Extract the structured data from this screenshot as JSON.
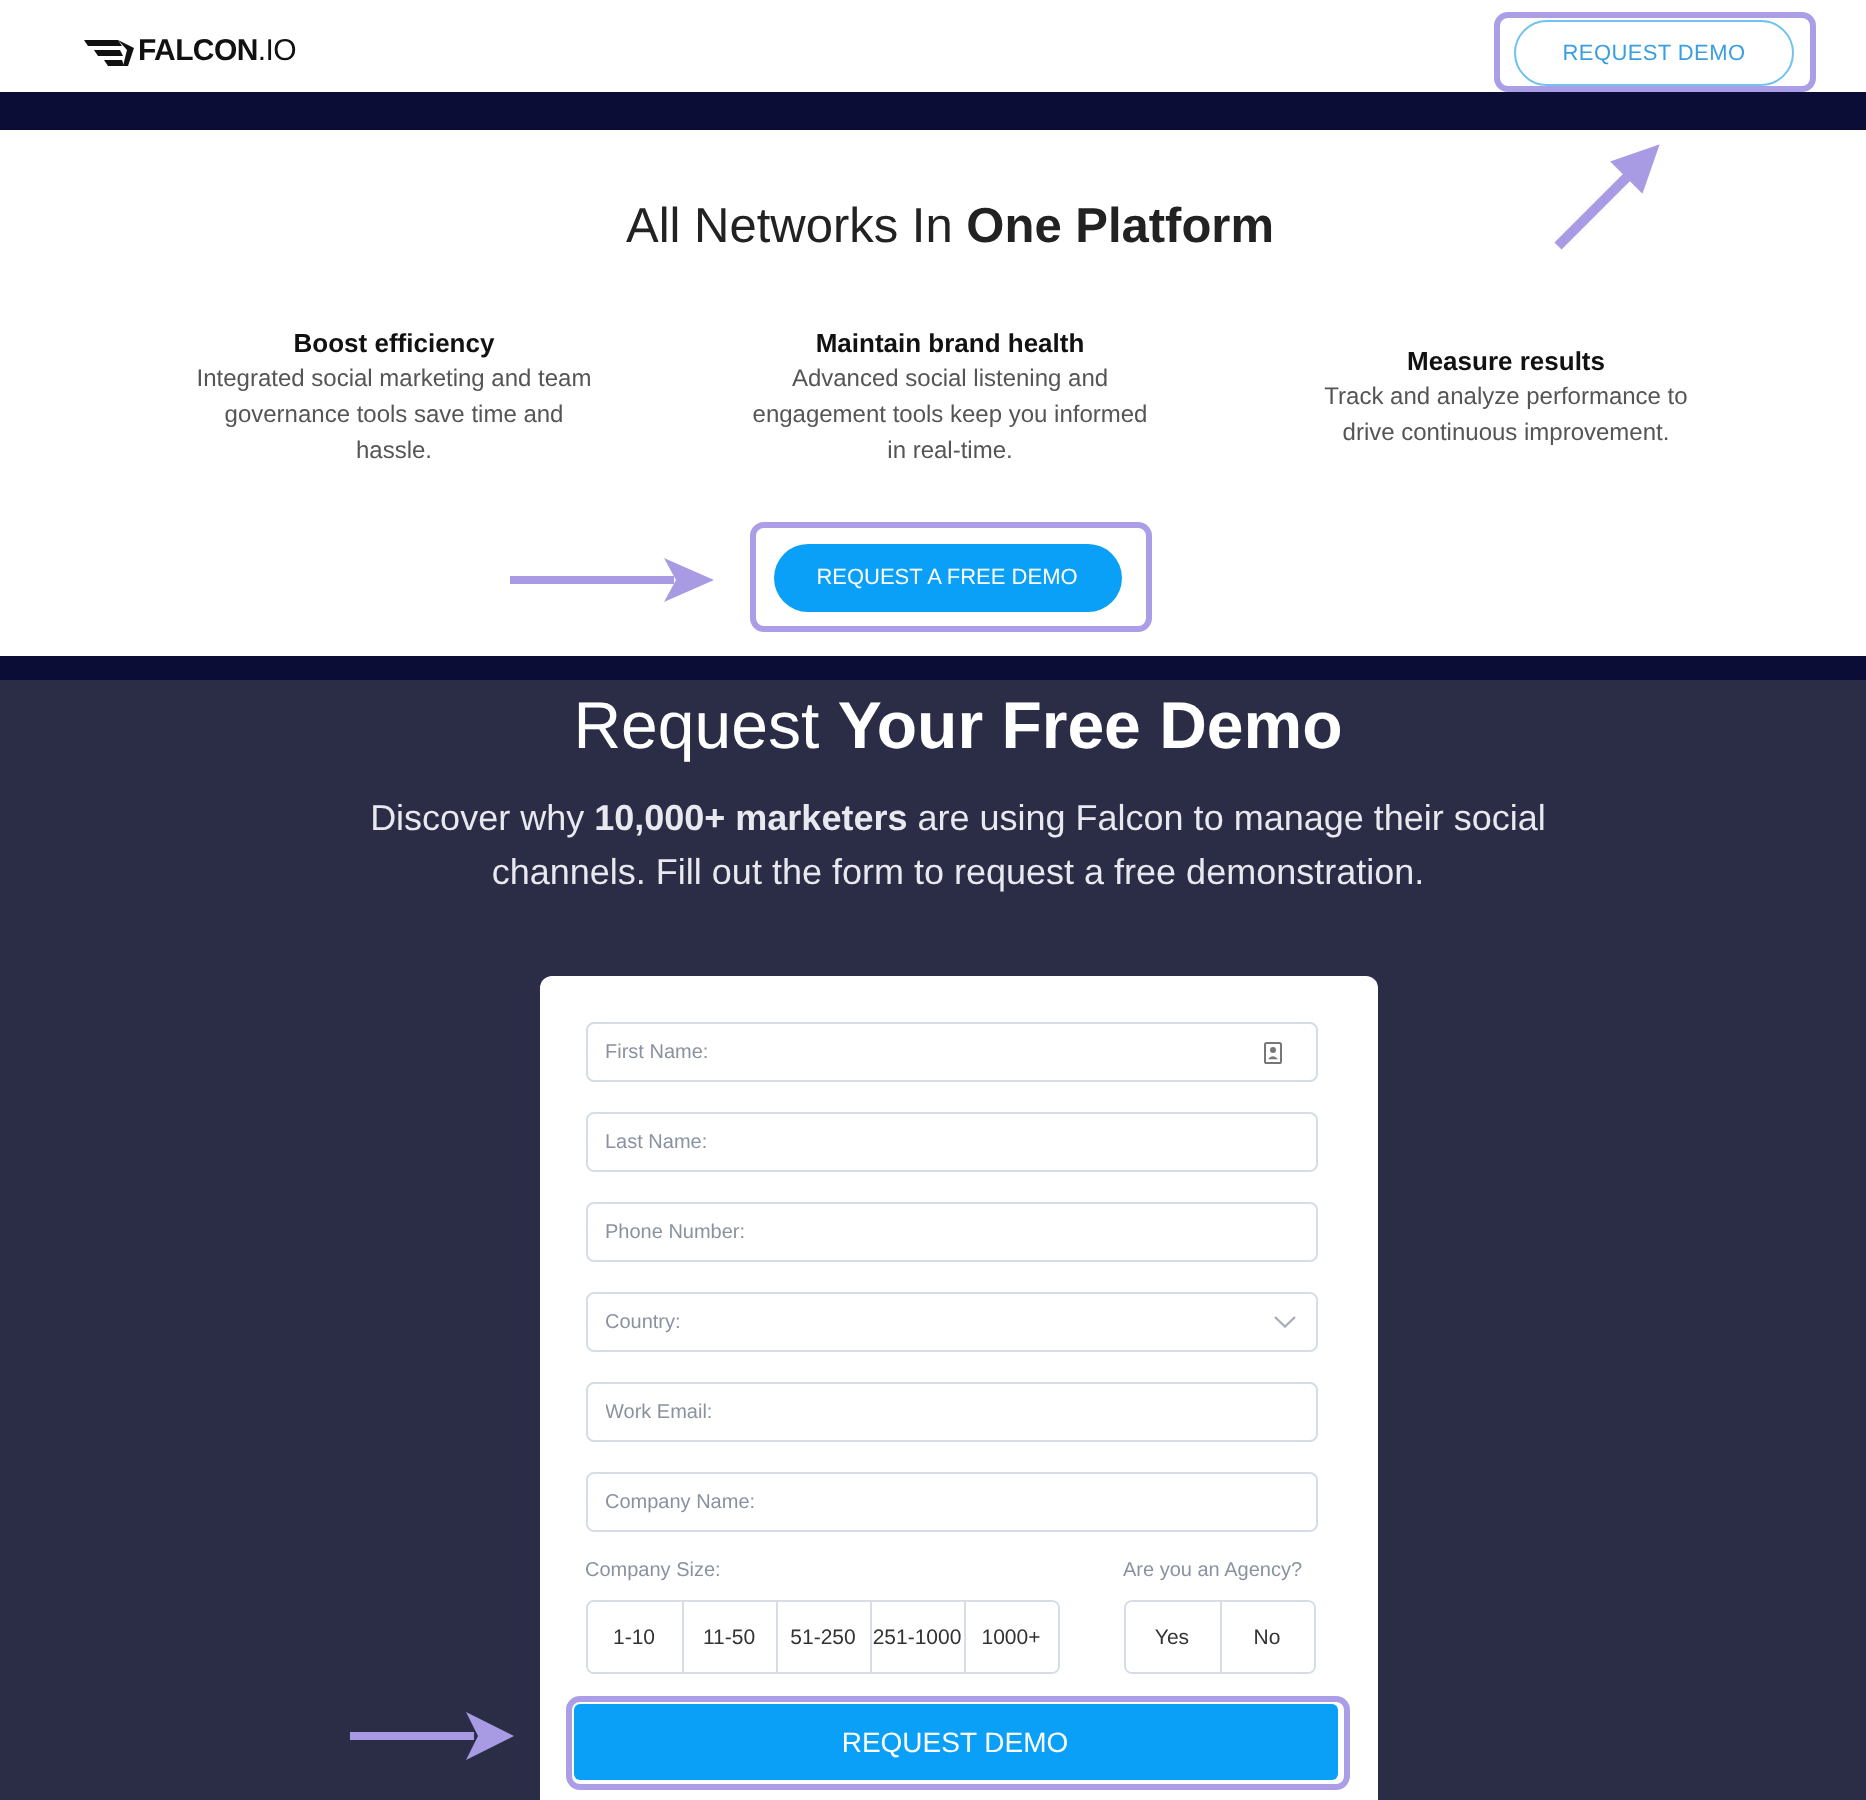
{
  "header": {
    "logo": "**FALCON**.IO",
    "button": {
      "label": "REQUEST DEMO",
      "highlighted": true
    }
  },
  "features_section": {
    "heading": "All Networks In **One Platform**",
    "features": [
      {
        "title": "Boost efficiency",
        "text": "Integrated social marketing and team governance tools save time and hassle."
      },
      {
        "title": "Maintain brand health",
        "text": "Advanced social listening and engagement tools keep you informed in real-time."
      },
      {
        "title": "Measure results",
        "text": "Track and analyze performance to drive continuous improvement."
      }
    ],
    "button": {
      "label": "REQUEST A FREE DEMO",
      "highlighted": true
    }
  },
  "demo_section": {
    "heading": "Request **Your Free Demo**",
    "intro": "Discover why **10,000+ marketers** are using Falcon to manage their social channels. Fill out the form to request a free demonstration.",
    "form": {
      "fields": [
        {
          "kind": "text",
          "placeholder": "First Name:",
          "autofill": true
        },
        {
          "kind": "text",
          "placeholder": "Last Name:",
          "autofill": false
        },
        {
          "kind": "text",
          "placeholder": "Phone Number:",
          "autofill": false
        },
        {
          "kind": "select",
          "placeholder": "Country:",
          "autofill": false
        },
        {
          "kind": "text",
          "placeholder": "Work Email:",
          "autofill": false
        },
        {
          "kind": "text",
          "placeholder": "Company Name:",
          "autofill": false
        }
      ],
      "company_size": {
        "label": "Company Size:",
        "options": [
          {
            "label": "1-10",
            "selected": false
          },
          {
            "label": "11-50",
            "selected": false
          },
          {
            "label": "51-250",
            "selected": false
          },
          {
            "label": "251-1000",
            "selected": false
          },
          {
            "label": "1000+",
            "selected": false
          }
        ]
      },
      "agency": {
        "label": "Are you an Agency?",
        "options": [
          {
            "label": "Yes",
            "selected": false
          },
          {
            "label": "No",
            "selected": false
          }
        ]
      },
      "submit": {
        "label": "REQUEST DEMO",
        "highlighted": true
      }
    }
  }
}
